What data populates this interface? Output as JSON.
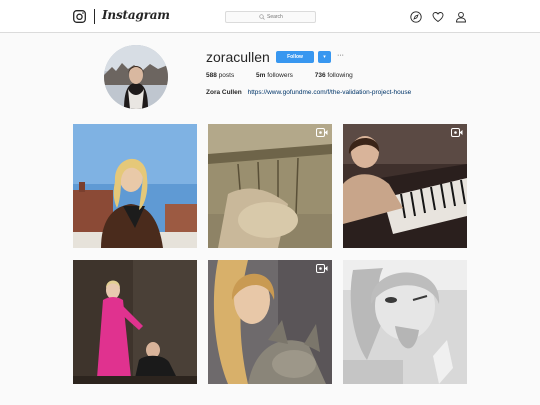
{
  "brand": {
    "name": "Instagram"
  },
  "search": {
    "placeholder": "Search"
  },
  "nav": {
    "icons": [
      "compass-icon",
      "heart-icon",
      "person-icon"
    ]
  },
  "profile": {
    "username": "zoracullen",
    "follow_label": "Follow",
    "dropdown_label": "▾",
    "more_label": "···",
    "stats": {
      "posts_count": "588",
      "posts_label": "posts",
      "followers_count": "5m",
      "followers_label": "followers",
      "following_count": "736",
      "following_label": "following"
    },
    "full_name": "Zora Cullen",
    "link": "https://www.gofundme.com/f/the-validation-project-house"
  },
  "posts": [
    {
      "type": "photo"
    },
    {
      "type": "video"
    },
    {
      "type": "video"
    },
    {
      "type": "photo"
    },
    {
      "type": "video"
    },
    {
      "type": "photo"
    }
  ],
  "colors": {
    "accent": "#3897f0",
    "link": "#003569",
    "border": "#dbdbdb",
    "background": "#fafafa"
  }
}
